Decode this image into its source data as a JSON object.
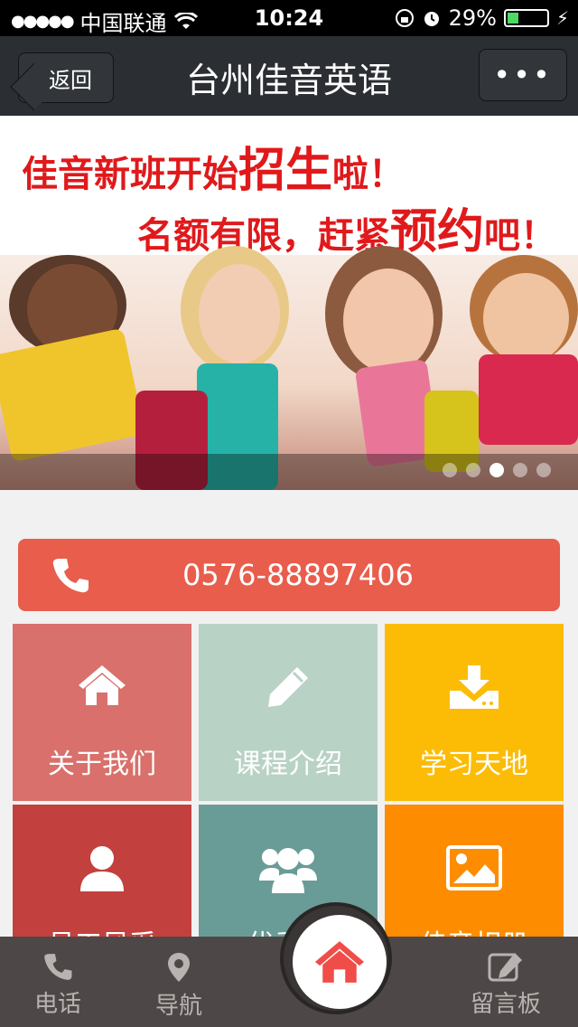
{
  "status_bar": {
    "carrier": "中国联通",
    "time": "10:24",
    "battery": "29%",
    "signal_bars": 5
  },
  "nav": {
    "back_label": "返回",
    "title": "台州佳音英语",
    "more_label": "•••"
  },
  "banner": {
    "line1_prefix": "佳音新班开始",
    "line1_emph": "招生",
    "line1_suffix": "啦！",
    "line2_prefix": "名额有限，赶紧",
    "line2_emph": "预约",
    "line2_suffix": "吧！",
    "slide_count": 5,
    "active_slide": 3
  },
  "phone": {
    "number": "0576-88897406"
  },
  "tiles": [
    {
      "label": "关于我们",
      "icon": "home-icon",
      "color": "#d9706b"
    },
    {
      "label": "课程介绍",
      "icon": "pencil-icon",
      "color": "#b9d2c6"
    },
    {
      "label": "学习天地",
      "icon": "download-icon",
      "color": "#fcbc05"
    },
    {
      "label": "员工风采",
      "icon": "user-icon",
      "color": "#c2413f"
    },
    {
      "label": "优秀…",
      "icon": "group-icon",
      "color": "#6a9c97"
    },
    {
      "label": "佳音相册",
      "icon": "picture-icon",
      "color": "#fe8c00"
    }
  ],
  "tab_bar": {
    "call_label": "电话",
    "navigate_label": "导航",
    "message_label": "留言板",
    "home_icon": "home-icon"
  },
  "colors": {
    "nav_bg": "#2b2e32",
    "phone_button": "#e95d4c",
    "tab_bar": "#4d4847",
    "home_icon": "#f04d48"
  }
}
